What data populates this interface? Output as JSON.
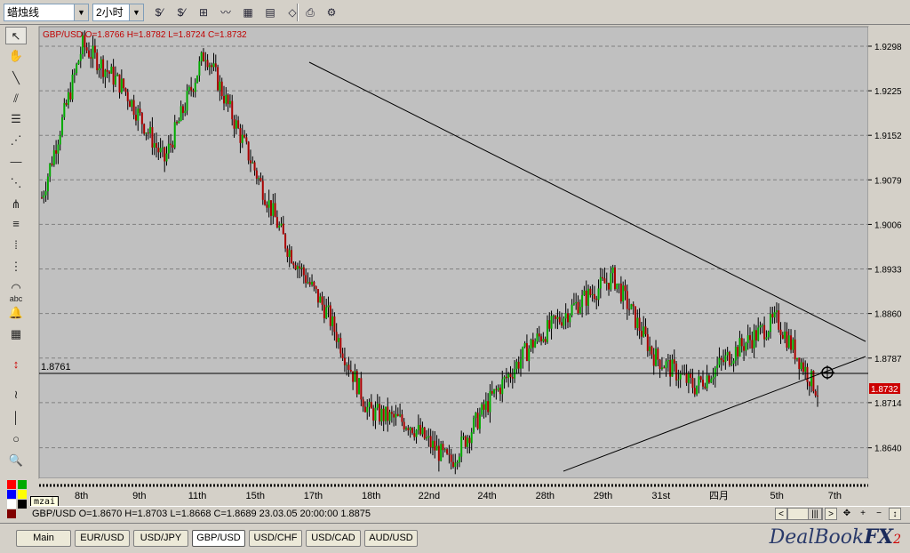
{
  "toolbar": {
    "chart_type": "蜡烛线",
    "timeframe": "2小时"
  },
  "tooltip": "mzai",
  "chart": {
    "header": "GBP/USD O=1.8766 H=1.8782 L=1.8724 C=1.8732",
    "hline_label": "1.8761",
    "price_tag": "1.8732",
    "y_ticks": [
      "1.9298",
      "1.9225",
      "1.9152",
      "1.9079",
      "1.9006",
      "1.8933",
      "1.8860",
      "1.8787",
      "1.8714",
      "1.8640"
    ],
    "x_ticks": [
      "8th",
      "9th",
      "11th",
      "15th",
      "17th",
      "18th",
      "22nd",
      "24th",
      "28th",
      "29th",
      "31st",
      "四月",
      "5th",
      "7th"
    ],
    "colors": {
      "bg": "#c0c0c0",
      "up": "#00aa00",
      "down": "#aa0000",
      "grid": "#808080"
    }
  },
  "status": {
    "text": "GBP/USD O=1.8670 H=1.8703 L=1.8668 C=1.8689   23.03.05 20:00:00 1.8875"
  },
  "tabs": [
    {
      "label": "Main"
    },
    {
      "label": "EUR/USD"
    },
    {
      "label": "USD/JPY"
    },
    {
      "label": "GBP/USD"
    },
    {
      "label": "USD/CHF"
    },
    {
      "label": "USD/CAD"
    },
    {
      "label": "AUD/USD"
    }
  ],
  "logo": {
    "a": "DealBook",
    "b": "FX",
    "c": "2"
  },
  "chart_data": {
    "type": "candlestick",
    "title": "GBP/USD",
    "ylim": [
      1.859,
      1.933
    ],
    "key_points": [
      {
        "x": "8th",
        "y": 1.905
      },
      {
        "x": "9th",
        "y": 1.93
      },
      {
        "x": "11th",
        "y": 1.923
      },
      {
        "x": "15th",
        "y": 1.911
      },
      {
        "x": "17th",
        "y": 1.929
      },
      {
        "x": "18th",
        "y": 1.913
      },
      {
        "x": "18th",
        "y": 1.897
      },
      {
        "x": "22nd",
        "y": 1.886
      },
      {
        "x": "22nd",
        "y": 1.87
      },
      {
        "x": "24th",
        "y": 1.868
      },
      {
        "x": "28th",
        "y": 1.8615
      },
      {
        "x": "29th",
        "y": 1.872
      },
      {
        "x": "29th",
        "y": 1.881
      },
      {
        "x": "31st",
        "y": 1.887
      },
      {
        "x": "31st",
        "y": 1.892
      },
      {
        "x": "四月",
        "y": 1.879
      },
      {
        "x": "四月",
        "y": 1.874
      },
      {
        "x": "5th",
        "y": 1.88
      },
      {
        "x": "7th",
        "y": 1.885
      },
      {
        "x": "7th",
        "y": 1.8732
      }
    ]
  }
}
